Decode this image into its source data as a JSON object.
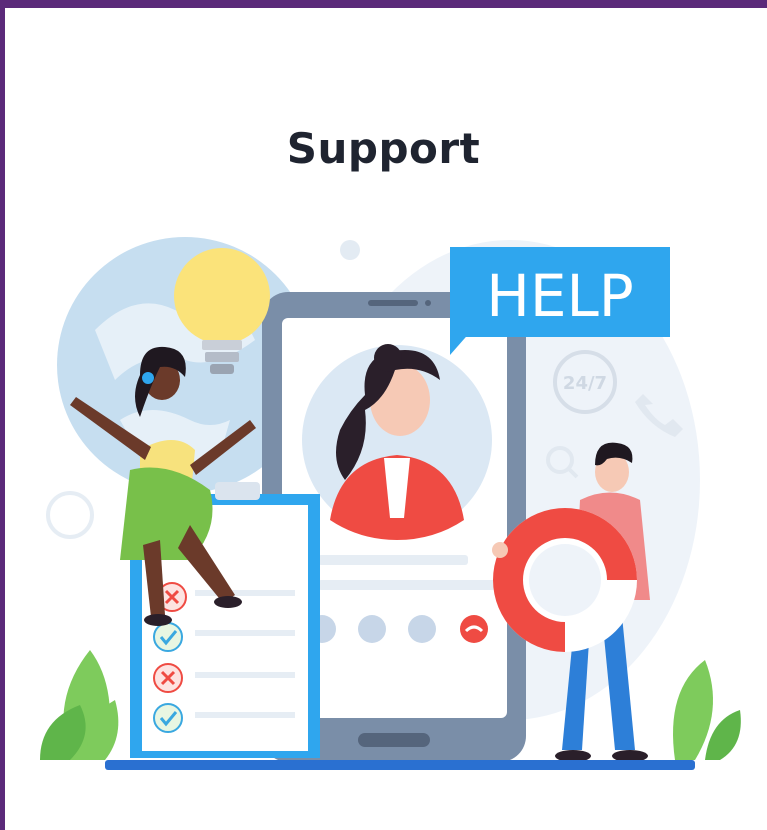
{
  "title": "Support",
  "help_sign": "HELP",
  "clock_label": "24/7",
  "colors": {
    "border": "#5b2a7a",
    "help_blue": "#2fa6ee",
    "bulb": "#fbe37a",
    "red": "#ef4b43",
    "green_leaf": "#7ecb5c",
    "dress_green": "#78c04a",
    "shirt_yellow": "#f7e27d",
    "jeans_blue": "#2d7fd8"
  },
  "checklist": [
    {
      "status": "cross"
    },
    {
      "status": "check"
    },
    {
      "status": "cross"
    },
    {
      "status": "check"
    }
  ]
}
